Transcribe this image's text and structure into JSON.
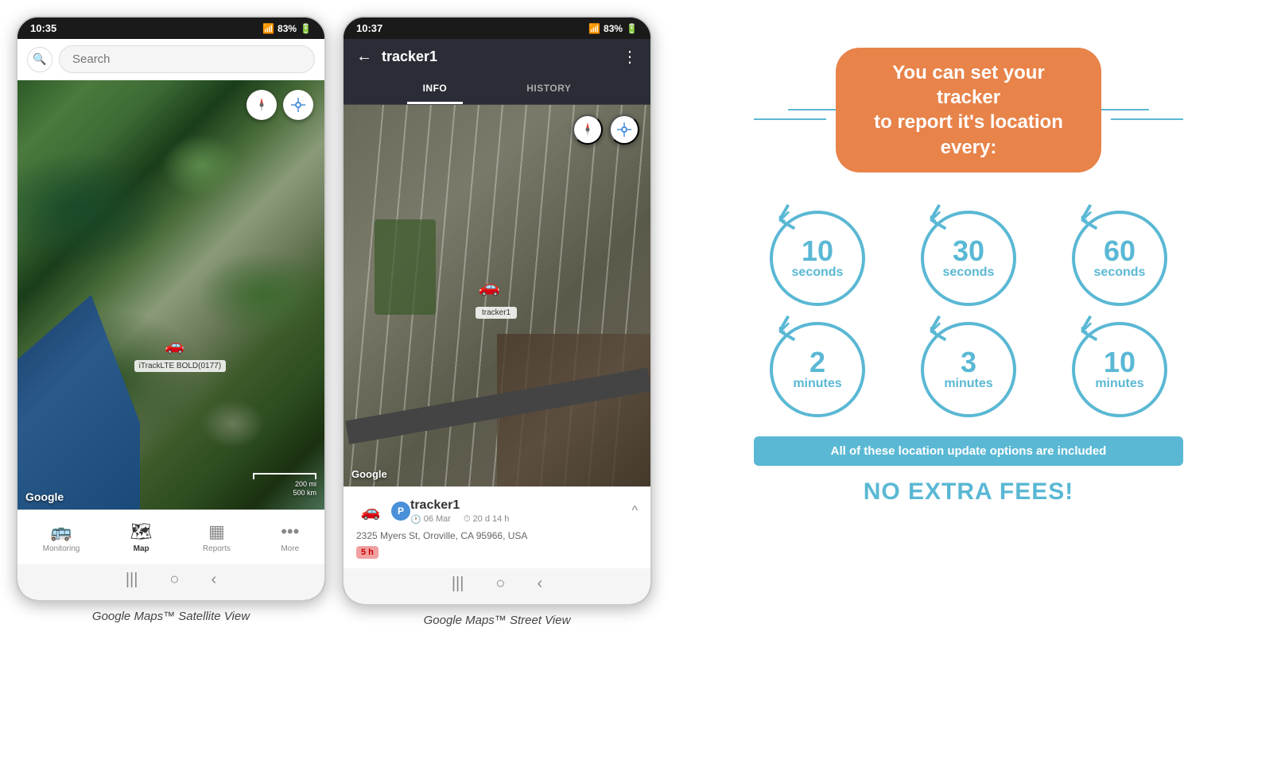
{
  "phone1": {
    "status_time": "10:35",
    "status_signal": "▲▲▲",
    "status_battery": "83%",
    "search_placeholder": "Search",
    "nav_items": [
      {
        "icon": "🚌",
        "label": "Monitoring",
        "active": false
      },
      {
        "icon": "🗺",
        "label": "Map",
        "active": true
      },
      {
        "icon": "📊",
        "label": "Reports",
        "active": false
      },
      {
        "icon": "•••",
        "label": "More",
        "active": false
      }
    ],
    "tracker_label": "iTrackLTE BOLD(0177)",
    "google_label": "Google",
    "scale_200mi": "200 mi",
    "scale_500km": "500 km",
    "caption": "Google Maps™ Satellite View"
  },
  "phone2": {
    "status_time": "10:37",
    "status_signal": "▲▲▲",
    "status_battery": "83%",
    "title": "tracker1",
    "tab_info": "INFO",
    "tab_history": "HISTORY",
    "google_label": "Google",
    "tracker_name": "tracker1",
    "tracker_date": "06 Mar",
    "tracker_duration": "20 d 14 h",
    "tracker_address": "2325 Myers St, Oroville, CA 95966, USA",
    "tracker_badge": "5 h",
    "caption": "Google Maps™ Street View"
  },
  "promo": {
    "title_line1": "You can set your tracker",
    "title_line2": "to report it's location every:",
    "circles": [
      {
        "number": "10",
        "unit": "seconds"
      },
      {
        "number": "30",
        "unit": "seconds"
      },
      {
        "number": "60",
        "unit": "seconds"
      },
      {
        "number": "2",
        "unit": "minutes"
      },
      {
        "number": "3",
        "unit": "minutes"
      },
      {
        "number": "10",
        "unit": "minutes"
      }
    ],
    "included_text": "All of these location update options are included",
    "no_fees_text": "NO EXTRA FEES!"
  }
}
